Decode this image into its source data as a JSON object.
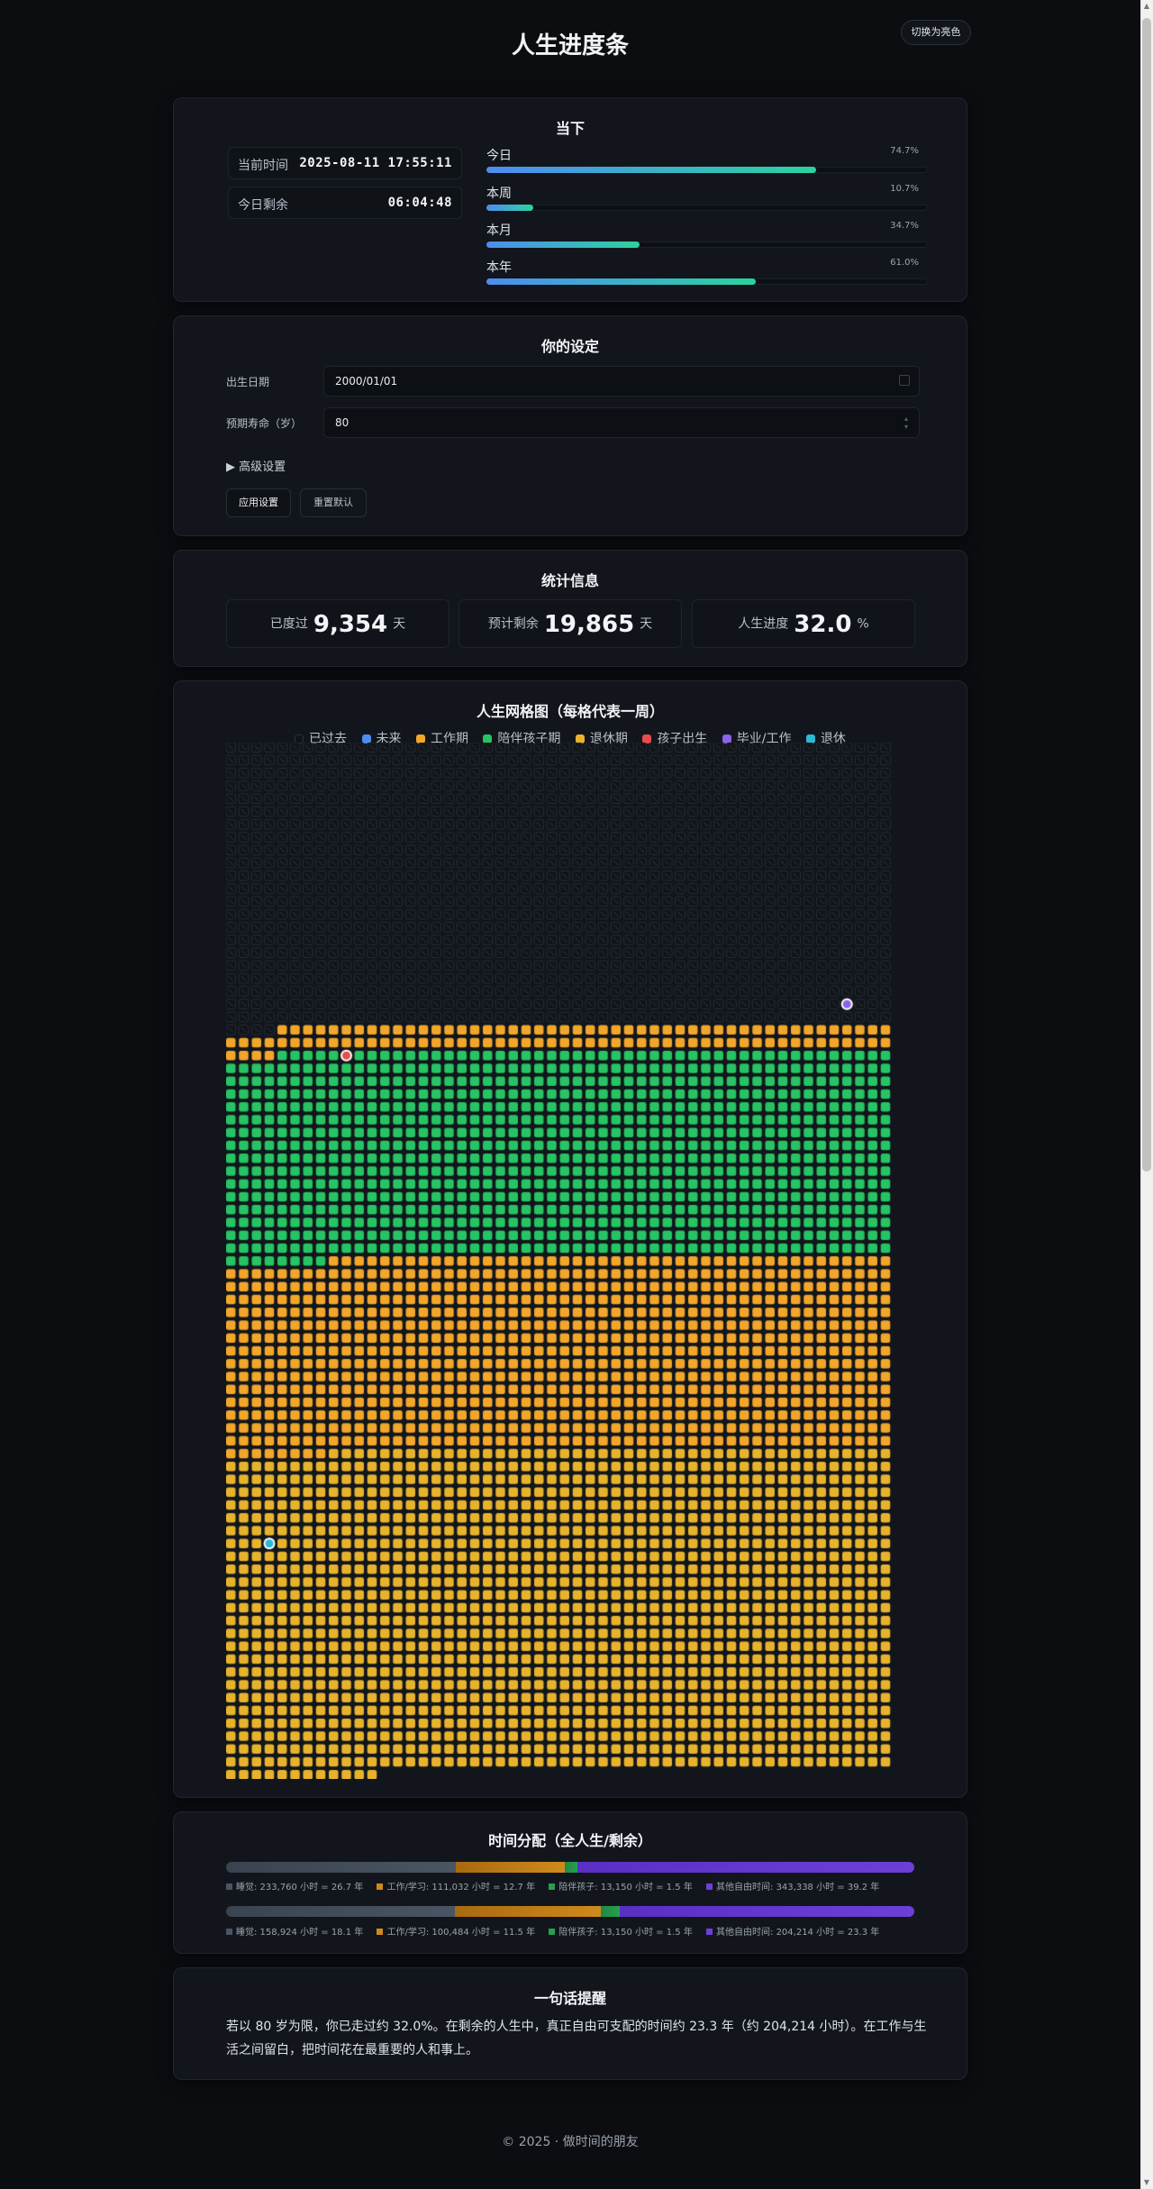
{
  "page": {
    "title": "人生进度条",
    "theme_toggle": "切换为亮色"
  },
  "now": {
    "title": "当下",
    "current_time_label": "当前时间",
    "current_time_value": "2025-08-11 17:55:11",
    "remaining_label": "今日剩余",
    "remaining_value": "06:04:48",
    "progress": [
      {
        "label": "今日",
        "percent": "74.7%",
        "value": 74.7
      },
      {
        "label": "本周",
        "percent": "10.7%",
        "value": 10.7
      },
      {
        "label": "本月",
        "percent": "34.7%",
        "value": 34.7
      },
      {
        "label": "本年",
        "percent": "61.0%",
        "value": 61.0
      }
    ]
  },
  "settings": {
    "title": "你的设定",
    "birth_label": "出生日期",
    "birth_value": "2000/01/01",
    "life_label": "预期寿命（岁）",
    "life_value": "80",
    "advanced": "▶ 高级设置",
    "apply": "应用设置",
    "reset": "重置默认"
  },
  "stats": {
    "title": "统计信息",
    "items": [
      {
        "label": "已度过",
        "value": "9,354",
        "unit": "天"
      },
      {
        "label": "预计剩余",
        "value": "19,865",
        "unit": "天"
      },
      {
        "label": "人生进度",
        "value": "32.0",
        "unit": "%"
      }
    ]
  },
  "grid": {
    "title": "人生网格图（每格代表一周）",
    "legend": [
      {
        "label": "已过去",
        "color": "#111419"
      },
      {
        "label": "未来",
        "color": "#4e8cf0"
      },
      {
        "label": "工作期",
        "color": "#f2a62a"
      },
      {
        "label": "陪伴孩子期",
        "color": "#26c463"
      },
      {
        "label": "退休期",
        "color": "#e8b32c"
      },
      {
        "label": "孩子出生",
        "color": "#e84c4c"
      },
      {
        "label": "毕业/工作",
        "color": "#8a63e8"
      },
      {
        "label": "退休",
        "color": "#2fb7d6"
      }
    ],
    "total_weeks": 4172,
    "passed_weeks": 1336,
    "work_start_week": 1148,
    "kids_start_week": 1252,
    "kids_end_week": 2088,
    "retire_week": 2868,
    "markers": [
      {
        "type": "graduate",
        "week": 1088,
        "color": "#8a63e8"
      },
      {
        "type": "child",
        "week": 1257,
        "color": "#e84c4c"
      },
      {
        "type": "retire",
        "week": 3227,
        "color": "#2fb7d6"
      }
    ],
    "colors": {
      "passed": "#111419",
      "work": "#f2a62a",
      "kids": "#26c463",
      "retire": "#e8b32c"
    }
  },
  "time": {
    "title": "时间分配（全人生/剩余）",
    "rows": [
      {
        "segments": [
          {
            "label": "睡觉: 233,760 小时 = 26.7 年",
            "value": 26.7,
            "color": "#4a5563"
          },
          {
            "label": "工作/学习: 111,032 小时 = 12.7 年",
            "value": 12.7,
            "color": "#d08a1c"
          },
          {
            "label": "陪伴孩子: 13,150 小时 = 1.5 年",
            "value": 1.5,
            "color": "#26a04f"
          },
          {
            "label": "其他自由时间: 343,338 小时 = 39.2 年",
            "value": 39.2,
            "color": "#6d3fd8"
          }
        ]
      },
      {
        "segments": [
          {
            "label": "睡觉: 158,924 小时 = 18.1 年",
            "value": 18.1,
            "color": "#4a5563"
          },
          {
            "label": "工作/学习: 100,484 小时 = 11.5 年",
            "value": 11.5,
            "color": "#d08a1c"
          },
          {
            "label": "陪伴孩子: 13,150 小时 = 1.5 年",
            "value": 1.5,
            "color": "#26a04f"
          },
          {
            "label": "其他自由时间: 204,214 小时 = 23.3 年",
            "value": 23.3,
            "color": "#6d3fd8"
          }
        ]
      }
    ]
  },
  "reminder": {
    "title": "一句话提醒",
    "text": "若以 80 岁为限，你已走过约 32.0%。在剩余的人生中，真正自由可支配的时间约 23.3 年（约 204,214 小时）。在工作与生活之间留白，把时间花在最重要的人和事上。"
  },
  "footer": {
    "text": "© 2025 · 做时间的朋友"
  }
}
